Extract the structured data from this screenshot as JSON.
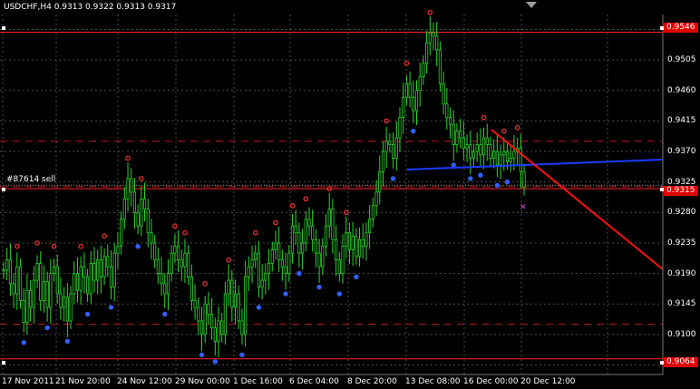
{
  "header": {
    "symbol_tf": "USDCHF,H4",
    "ohlc": "0.9313 0.9322 0.9313 0.9317"
  },
  "order_label": "#87614 sell",
  "price_labels": {
    "top": "0.9546",
    "mid": "0.9315",
    "bottom": "0.9064"
  },
  "y_axis": {
    "ticks": [
      "0.9550",
      "0.9505",
      "0.9460",
      "0.9415",
      "0.9370",
      "0.9325",
      "0.9280",
      "0.9235",
      "0.9190",
      "0.9145",
      "0.9100",
      "0.9055"
    ]
  },
  "x_axis": {
    "ticks": [
      "17 Nov 2011",
      "21 Nov 20:00",
      "24 Nov 12:00",
      "29 Nov 00:00",
      "1 Dec 16:00",
      "6 Dec 04:00",
      "8 Dec 20:00",
      "13 Dec 08:00",
      "16 Dec 00:00",
      "20 Dec 12:00"
    ]
  },
  "colors": {
    "background": "#000000",
    "grid": "#4d4d4d",
    "candles": "#2bd62b",
    "hline": "#ff2020",
    "dashed": "#c01818",
    "trendline_blue": "#1a3cff",
    "trendline_red": "#ff1010",
    "fractal_up": "#ff3030",
    "fractal_down": "#3060ff"
  },
  "chart_data": {
    "type": "candlestick",
    "symbol": "USDCHF",
    "timeframe": "H4",
    "ylim": [
      0.9041,
      0.9572
    ],
    "x_range": [
      "17 Nov 2011",
      "20 Dec 12:00"
    ],
    "horizontal_levels": [
      0.9546,
      0.9315,
      0.9064
    ],
    "dashed_levels": [
      0.9385,
      0.9318,
      0.9115
    ],
    "close_series": [
      0.9195,
      0.921,
      0.9175,
      0.916,
      0.92,
      0.915,
      0.9118,
      0.9165,
      0.914,
      0.918,
      0.9205,
      0.915,
      0.9178,
      0.914,
      0.919,
      0.92,
      0.916,
      0.914,
      0.9155,
      0.912,
      0.916,
      0.919,
      0.9165,
      0.92,
      0.9185,
      0.916,
      0.9205,
      0.918,
      0.921,
      0.9185,
      0.9215,
      0.92,
      0.917,
      0.922,
      0.923,
      0.927,
      0.93,
      0.933,
      0.931,
      0.928,
      0.926,
      0.93,
      0.9285,
      0.925,
      0.9235,
      0.921,
      0.919,
      0.9175,
      0.916,
      0.919,
      0.922,
      0.923,
      0.921,
      0.92,
      0.922,
      0.9185,
      0.915,
      0.914,
      0.912,
      0.91,
      0.9145,
      0.913,
      0.911,
      0.909,
      0.912,
      0.91,
      0.916,
      0.918,
      0.914,
      0.916,
      0.912,
      0.91,
      0.9185,
      0.92,
      0.921,
      0.922,
      0.917,
      0.918,
      0.919,
      0.9205,
      0.9225,
      0.9235,
      0.921,
      0.92,
      0.919,
      0.922,
      0.926,
      0.925,
      0.922,
      0.9235,
      0.927,
      0.926,
      0.924,
      0.922,
      0.92,
      0.923,
      0.926,
      0.9285,
      0.924,
      0.921,
      0.919,
      0.923,
      0.925,
      0.9225,
      0.9245,
      0.9215,
      0.924,
      0.923,
      0.925,
      0.927,
      0.929,
      0.931,
      0.934,
      0.937,
      0.9385,
      0.938,
      0.936,
      0.939,
      0.942,
      0.945,
      0.947,
      0.945,
      0.943,
      0.946,
      0.948,
      0.95,
      0.953,
      0.9545,
      0.954,
      0.952,
      0.947,
      0.944,
      0.942,
      0.941,
      0.938,
      0.94,
      0.939,
      0.9375,
      0.938,
      0.936,
      0.937,
      0.938,
      0.9365,
      0.939,
      0.938,
      0.936,
      0.937,
      0.935,
      0.9365,
      0.937,
      0.9355,
      0.936,
      0.937,
      0.9375,
      0.934,
      0.9317
    ]
  }
}
